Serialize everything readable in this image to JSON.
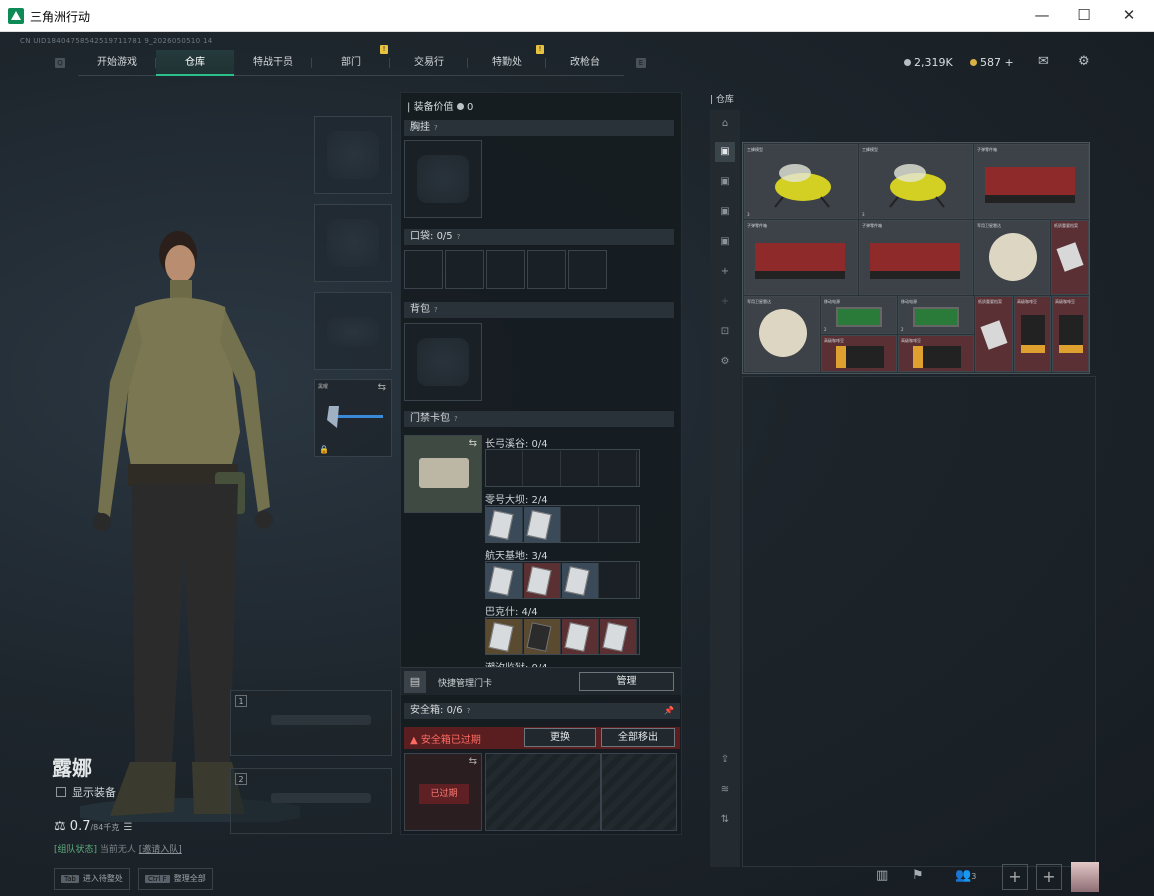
{
  "window": {
    "title": "三角洲行动",
    "minimize": "—",
    "maximize": "☐",
    "close": "✕"
  },
  "uid": "CN UID18404758542519711781 9_2026050510 14",
  "nav": {
    "left_key": "Q",
    "right_key": "E",
    "tabs": [
      {
        "label": "开始游戏",
        "badge": ""
      },
      {
        "label": "仓库",
        "badge": ""
      },
      {
        "label": "特战干员",
        "badge": ""
      },
      {
        "label": "部门",
        "badge": "!"
      },
      {
        "label": "交易行",
        "badge": ""
      },
      {
        "label": "特勤处",
        "badge": "!"
      },
      {
        "label": "改枪台",
        "badge": ""
      }
    ],
    "active_index": 1
  },
  "currency": {
    "silver": "2,319K",
    "gold": "587",
    "gold_add": "+",
    "mail_icon": "mail-icon",
    "settings_icon": "gear-icon"
  },
  "character": {
    "name": "露娜",
    "show_equipment": "显示装备",
    "weight": "0.7",
    "weight_max": "/84千克",
    "team_status": "[组队状态]",
    "team_members": "当前无人",
    "team_invite": "[邀请入队]"
  },
  "melee_label": "黑曜",
  "weapon_slots": [
    "1",
    "2"
  ],
  "hints": [
    {
      "key": "Tab",
      "label": "进入待整处"
    },
    {
      "key": "Ctrl F",
      "label": "整理全部"
    }
  ],
  "loadout": {
    "value_label": "装备价值",
    "value": "0",
    "chest_rig": "胸挂",
    "pocket": "口袋:",
    "pocket_count": "0/5",
    "backpack": "背包",
    "keycard_bag": "门禁卡包",
    "help": "?",
    "keycard_groups": [
      {
        "name": "长弓溪谷: 0/4",
        "cards": 0
      },
      {
        "name": "零号大坝: 2/4",
        "cards": 2
      },
      {
        "name": "航天基地: 3/4",
        "cards": 3
      },
      {
        "name": "巴克什: 4/4",
        "cards": 4
      },
      {
        "name": "潮汐监狱: 0/4",
        "cards": 0
      }
    ],
    "quick_manage": "快捷管理门卡",
    "manage_button": "管理",
    "safe_box": "安全箱:",
    "safe_count": "0/6",
    "safe_expired": "安全箱已过期",
    "replace_button": "更换",
    "remove_all_button": "全部移出",
    "expired_tag": "已过期"
  },
  "warehouse": {
    "title": "仓库",
    "items": [
      {
        "name": "工蜂模型",
        "count": "3"
      },
      {
        "name": "工蜂模型",
        "count": "3"
      },
      {
        "name": "子弹零件箱",
        "count": ""
      },
      {
        "name": "子弹零件箱",
        "count": ""
      },
      {
        "name": "子弹零件箱",
        "count": ""
      },
      {
        "name": "军用卫星雷达",
        "count": ""
      },
      {
        "name": "纸质重要档案",
        "count": ""
      },
      {
        "name": "军用卫星雷达",
        "count": ""
      },
      {
        "name": "移动电源",
        "count": "2"
      },
      {
        "name": "移动电源",
        "count": "2"
      },
      {
        "name": "纸质重要档案",
        "count": ""
      },
      {
        "name": "高级咖啡豆",
        "count": ""
      },
      {
        "name": "高级咖啡豆",
        "count": ""
      },
      {
        "name": "高级咖啡豆",
        "count": ""
      },
      {
        "name": "高级咖啡豆",
        "count": ""
      }
    ]
  },
  "bottom": {
    "friends_count": "3",
    "plus": "+"
  }
}
